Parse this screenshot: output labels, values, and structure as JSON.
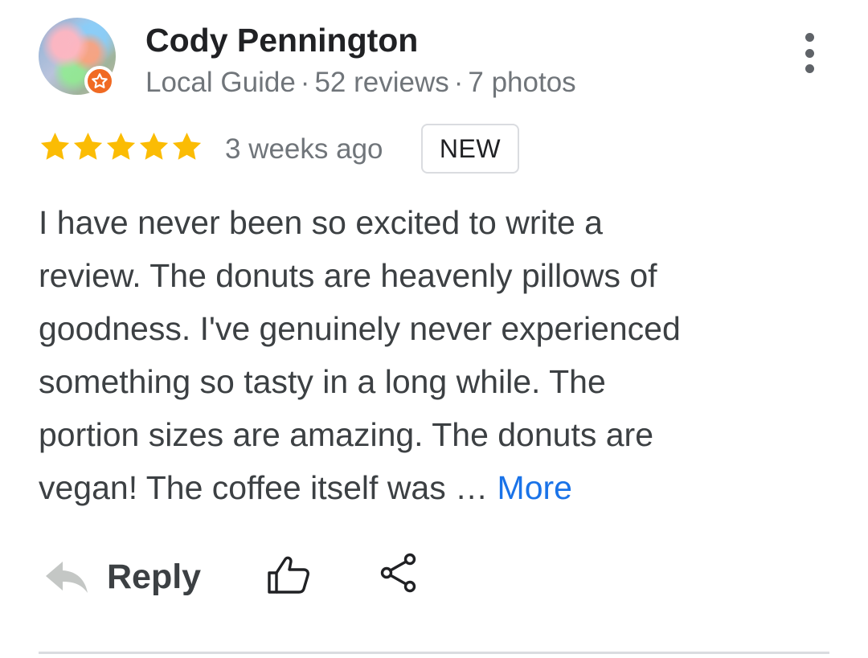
{
  "author": {
    "name": "Cody Pennington",
    "badge": "Local Guide",
    "reviews": "52 reviews",
    "photos": "7 photos",
    "separator": "·",
    "avatar_icon": "profile-photo",
    "badge_icon": "local-guide-star-icon"
  },
  "review": {
    "rating": 5,
    "max_rating": 5,
    "time": "3 weeks ago",
    "new_label": "NEW",
    "text_lines": [
      "I have never been so excited to write a",
      "review. The donuts are heavenly pillows of",
      "goodness. I've genuinely never experienced",
      "something so tasty in a long while. The",
      "portion sizes are amazing. The donuts are",
      "vegan! The coffee itself was …"
    ],
    "more_label": "More"
  },
  "actions": {
    "reply_label": "Reply",
    "reply_icon": "reply-arrow-icon",
    "like_icon": "thumbs-up-icon",
    "share_icon": "share-icon",
    "menu_icon": "more-vert-icon"
  },
  "colors": {
    "star": "#fbbc04",
    "link": "#1a73e8",
    "guide_badge": "#f06a23",
    "muted_text": "#70757a"
  }
}
